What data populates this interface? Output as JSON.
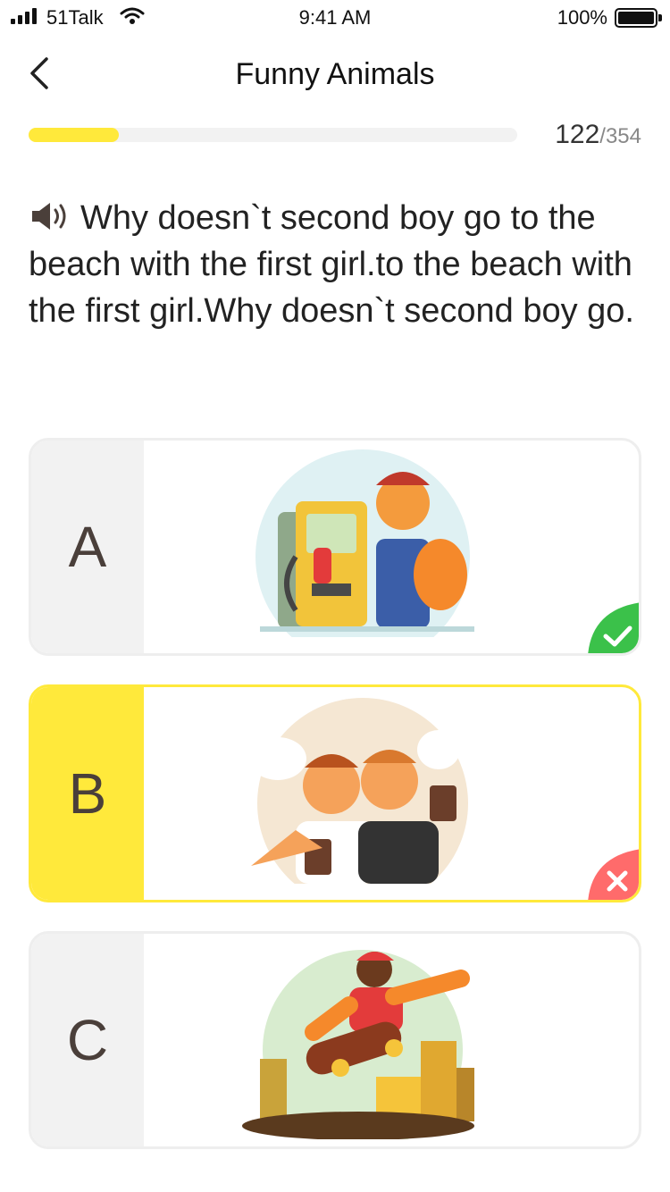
{
  "status": {
    "carrier": "51Talk",
    "time": "9:41 AM",
    "battery": "100%"
  },
  "nav": {
    "title": "Funny Animals"
  },
  "progress": {
    "current": "122",
    "total": "/354",
    "fraction": 0.185
  },
  "question": {
    "text": "Why doesn`t second boy go to the beach with the first girl.to the beach with the first girl.Why doesn`t second boy go."
  },
  "options": [
    {
      "letter": "A",
      "image": "gas-station-worker-illustration",
      "state": "correct"
    },
    {
      "letter": "B",
      "image": "two-friends-with-coffee-illustration",
      "state": "wrong-selected"
    },
    {
      "letter": "C",
      "image": "skateboarder-jump-illustration",
      "state": "none"
    }
  ],
  "colors": {
    "accent": "#ffe93b",
    "correct": "#3bc14a",
    "wrong": "#ff6b6b"
  },
  "icons": {
    "back": "chevron-left-icon",
    "speaker": "speaker-icon",
    "correct": "check-icon",
    "wrong": "close-icon"
  }
}
